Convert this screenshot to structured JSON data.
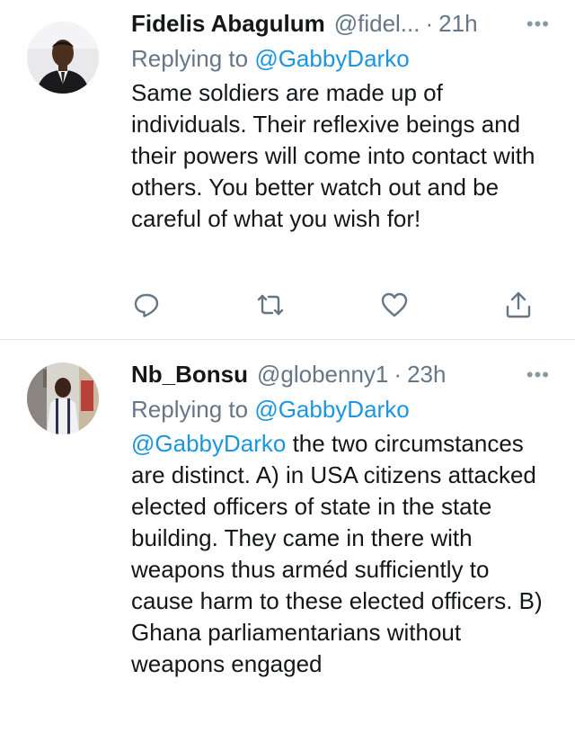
{
  "tweets": [
    {
      "display_name": "Fidelis Abagulum",
      "handle": "@fidel...",
      "separator": "·",
      "time": "21h",
      "more": "•••",
      "replying_prefix": "Replying to ",
      "replying_to": "@GabbyDarko",
      "text": "Same soldiers are made up of individuals. Their reflexive beings and their powers will come into contact with others. You better watch out and be careful of what you wish for!"
    },
    {
      "display_name": "Nb_Bonsu",
      "handle": "@globenny1",
      "separator": "·",
      "time": "23h",
      "more": "•••",
      "replying_prefix": "Replying to ",
      "replying_to": "@GabbyDarko",
      "mention": "@GabbyDarko",
      "text": " the two circumstances are distinct. A) in USA citizens attacked elected officers of state in the state building. They came in there with weapons thus arméd sufficiently to cause harm to these elected officers. B) Ghana parliamentarians without weapons engaged"
    }
  ],
  "icons": {
    "reply": "reply-icon",
    "retweet": "retweet-icon",
    "like": "heart-icon",
    "share": "share-icon"
  },
  "colors": {
    "link": "#1b95e0",
    "secondary_text": "#657786",
    "divider": "#e1e8ed"
  }
}
